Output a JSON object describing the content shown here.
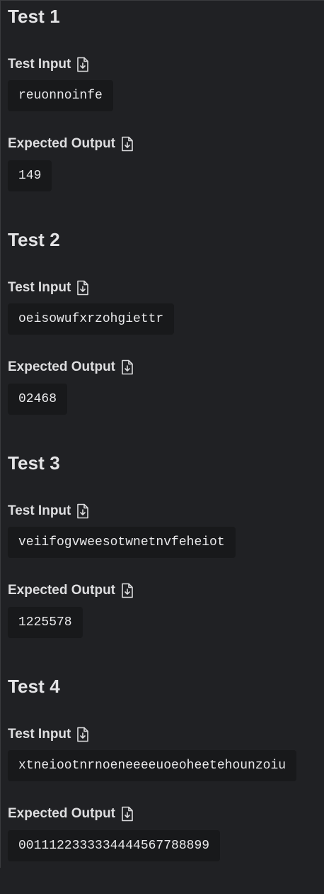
{
  "tests": [
    {
      "title": "Test 1",
      "input_label": "Test Input",
      "input_value": "reuonnoinfe",
      "output_label": "Expected Output",
      "output_value": "149"
    },
    {
      "title": "Test 2",
      "input_label": "Test Input",
      "input_value": "oeisowufxrzohgiettr",
      "output_label": "Expected Output",
      "output_value": "02468"
    },
    {
      "title": "Test 3",
      "input_label": "Test Input",
      "input_value": "veiifogvweesotwnetnvfeheiot",
      "output_label": "Expected Output",
      "output_value": "1225578"
    },
    {
      "title": "Test 4",
      "input_label": "Test Input",
      "input_value": "xtneiootnrnoeneeeeuoeoheetehounzoiu",
      "output_label": "Expected Output",
      "output_value": "0011122333334444567788899"
    }
  ],
  "icons": {
    "download": "download-file-icon"
  },
  "colors": {
    "background": "#202124",
    "code_background": "#18191b",
    "text": "#e6e6e8"
  }
}
